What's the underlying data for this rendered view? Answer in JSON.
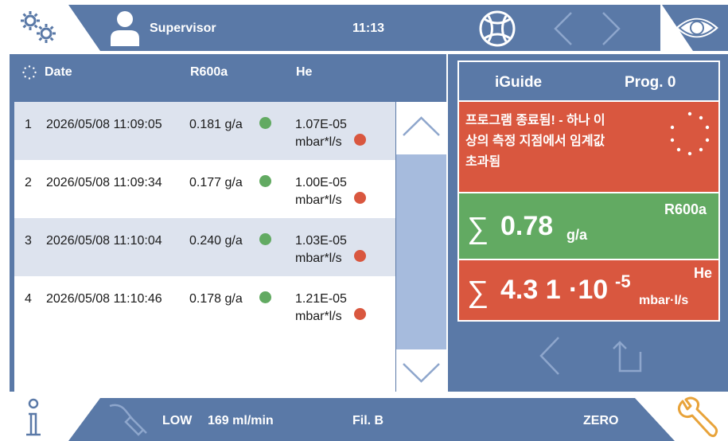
{
  "topbar": {
    "user": "Supervisor",
    "time": "11:13"
  },
  "table": {
    "headers": {
      "date": "Date",
      "r600a": "R600a",
      "he": "He"
    },
    "rows": [
      {
        "num": "1",
        "date": "2026/05/08 11:09:05",
        "r600a": "0.181 g/a",
        "r600a_status": "ok",
        "he_value": "1.07E-05",
        "he_unit": "mbar*l/s",
        "he_status": "fail"
      },
      {
        "num": "2",
        "date": "2026/05/08 11:09:34",
        "r600a": "0.177 g/a",
        "r600a_status": "ok",
        "he_value": "1.00E-05",
        "he_unit": "mbar*l/s",
        "he_status": "fail"
      },
      {
        "num": "3",
        "date": "2026/05/08 11:10:04",
        "r600a": "0.240 g/a",
        "r600a_status": "ok",
        "he_value": "1.03E-05",
        "he_unit": "mbar*l/s",
        "he_status": "fail"
      },
      {
        "num": "4",
        "date": "2026/05/08 11:10:46",
        "r600a": "0.178 g/a",
        "r600a_status": "ok",
        "he_value": "1.21E-05",
        "he_unit": "mbar*l/s",
        "he_status": "fail"
      }
    ]
  },
  "iguide": {
    "title": "iGuide",
    "program": "Prog. 0",
    "message_line1": "프로그램 종료됨! - 하나 이",
    "message_line2": "상의 측정 지점에서 임계값",
    "message_line3": "초과됨",
    "r600a": {
      "gas": "R600a",
      "sigma": "∑",
      "value": "0.78",
      "unit": "g/a"
    },
    "he": {
      "gas": "He",
      "sigma": "∑",
      "mantissa": "4.3 1",
      "times": "·10",
      "exponent": "-5",
      "unit": "mbar·l/s"
    }
  },
  "bottombar": {
    "mode": "LOW",
    "flow": "169 ml/min",
    "filter": "Fil. B",
    "zero": "ZERO"
  },
  "colors": {
    "bar_blue": "#5a79a7",
    "row_shade": "#dde3ee",
    "ok_green": "#62aa62",
    "fail_red": "#d9573f",
    "wrench_orange": "#e8a33a"
  }
}
